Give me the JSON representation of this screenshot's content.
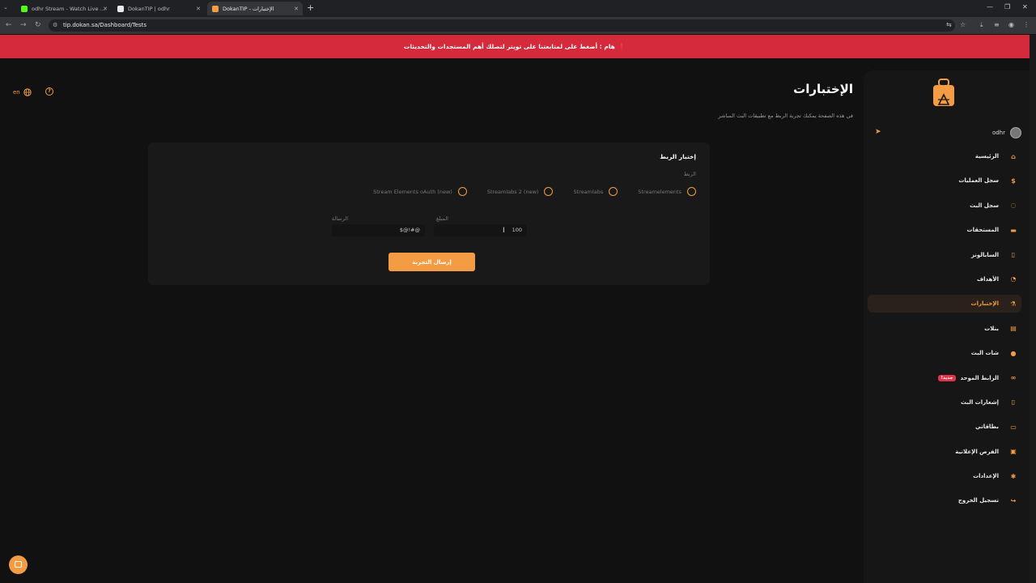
{
  "browser": {
    "tabs": [
      {
        "title": "odhr Stream - Watch Live on K",
        "favicon_color": "#53fc18",
        "active": false
      },
      {
        "title": "DokanTIP | odhr",
        "favicon_color": "#e8eaed",
        "active": false
      },
      {
        "title": "DokanTIP - الإختبارات",
        "favicon_color": "#f39c43",
        "active": true
      }
    ],
    "url": "tip.dokan.sa/Dashboard/Tests",
    "new_tab_label": "+"
  },
  "banner": {
    "text": "هام : أضغط على لمتابعتنا على تويتر لتصلك أهم المستجدات والتحديثات",
    "icon": "exclamation-icon"
  },
  "topbar": {
    "lang_label": "en",
    "help_label": "?"
  },
  "page": {
    "title": "الإختبارات",
    "subtitle": "في هذه الصفحة يمكنك تجربة الربط مع تطبيقات البث المباشر"
  },
  "test_card": {
    "title": "إختبار الربط",
    "link_label": "الربط",
    "options": [
      "Streamelements",
      "Streamlabs",
      "Streamlabs 2 (new)",
      "Stream Elements oAuth (new)"
    ],
    "amount_label": "المبلغ",
    "amount_value": "100",
    "message_label": "الرسالة",
    "message_value": "@#!@$",
    "submit_label": "إرسال التجربة"
  },
  "sidebar": {
    "username": "odhr",
    "items": [
      {
        "label": "الرئيسية",
        "icon": "home-icon"
      },
      {
        "label": "سجل العمليات",
        "icon": "dollar-icon"
      },
      {
        "label": "سجل البث",
        "icon": "broadcast-icon"
      },
      {
        "label": "المستحقات",
        "icon": "wallet-icon"
      },
      {
        "label": "السابالونز",
        "icon": "document-icon"
      },
      {
        "label": "الأهداف",
        "icon": "pie-chart-icon"
      },
      {
        "label": "الإختبارات",
        "icon": "test-icon",
        "active": true
      },
      {
        "label": "بنلات",
        "icon": "panel-icon"
      },
      {
        "label": "شات البث",
        "icon": "chat-bubbles-icon"
      },
      {
        "label": "الرابط الموحد",
        "icon": "link-icon",
        "badge": "جديد!"
      },
      {
        "label": "إشعارات البث",
        "icon": "mobile-icon"
      },
      {
        "label": "بطاقاتي",
        "icon": "card-icon"
      },
      {
        "label": "الفرص الإعلانية",
        "icon": "ad-icon"
      },
      {
        "label": "الإعدادات",
        "icon": "settings-icon"
      },
      {
        "label": "تسجيل الخروج",
        "icon": "logout-icon"
      }
    ]
  },
  "colors": {
    "accent": "#f39c43",
    "banner": "#d42a3b",
    "background": "#111111",
    "card": "#191919"
  }
}
